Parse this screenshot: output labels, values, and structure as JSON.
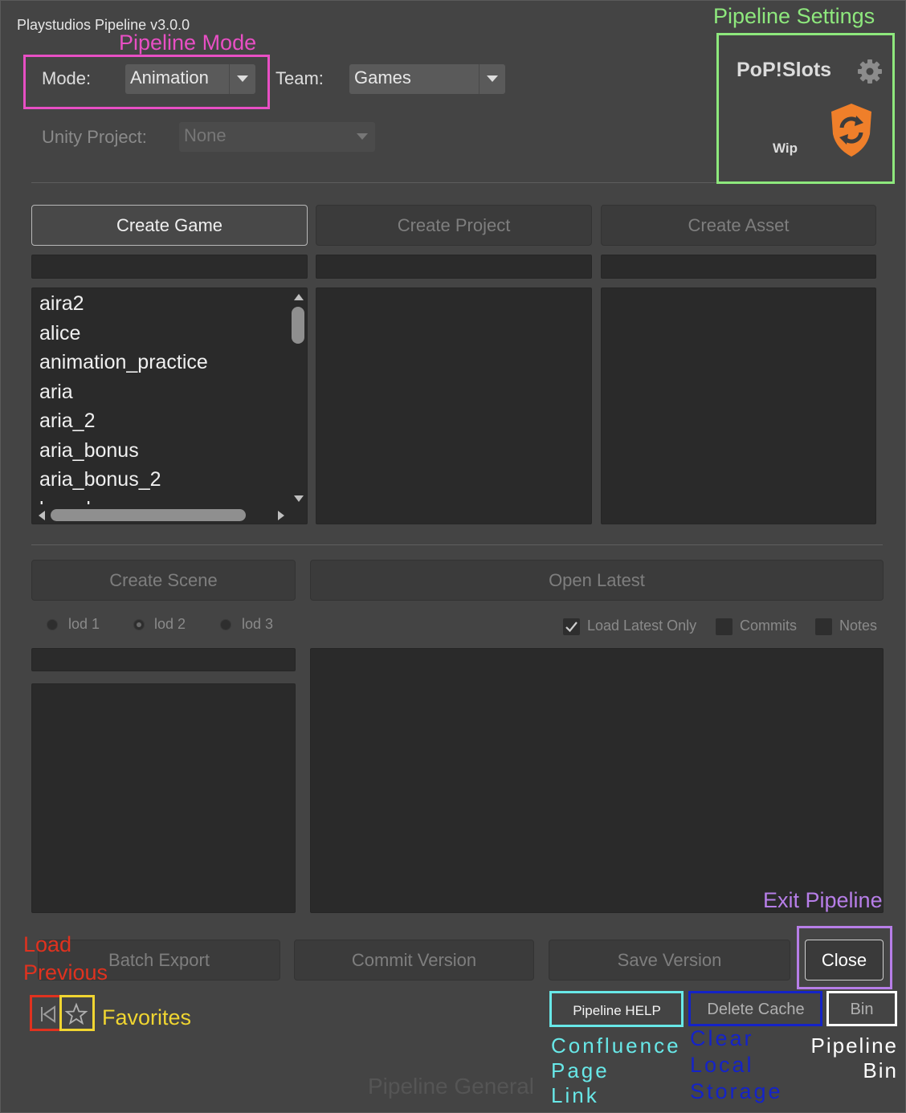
{
  "window": {
    "title": "Playstudios Pipeline v3.0.0"
  },
  "mode": {
    "label": "Mode:",
    "value": "Animation"
  },
  "team": {
    "label": "Team:",
    "value": "Games"
  },
  "unity": {
    "label": "Unity Project:",
    "value": "None"
  },
  "settings": {
    "game_name": "PoP!Slots",
    "status": "Wip"
  },
  "create_buttons": {
    "game": "Create Game",
    "project": "Create Project",
    "asset": "Create Asset"
  },
  "games_list": [
    "aira2",
    "alice",
    "animation_practice",
    "aria",
    "aria_2",
    "aria_bonus",
    "aria_bonus_2",
    "board"
  ],
  "scene": {
    "create_scene": "Create Scene",
    "open_latest": "Open Latest",
    "lods": [
      {
        "label": "lod 1",
        "selected": false
      },
      {
        "label": "lod 2",
        "selected": true
      },
      {
        "label": "lod 3",
        "selected": false
      }
    ],
    "load_latest_only": "Load Latest Only",
    "commits": "Commits",
    "notes": "Notes"
  },
  "actions": {
    "batch_export": "Batch Export",
    "commit_version": "Commit Version",
    "save_version": "Save Version",
    "close": "Close",
    "pipeline_help": "Pipeline HELP",
    "delete_cache": "Delete Cache",
    "bin": "Bin"
  },
  "footer_label": "Pipeline General",
  "annotations": {
    "pipeline_mode": "Pipeline Mode",
    "pipeline_settings": "Pipeline Settings",
    "exit_pipeline": "Exit Pipeline",
    "load_previous_1": "Load",
    "load_previous_2": "Previous",
    "favorites": "Favorites",
    "confluence_1": "Confluence",
    "confluence_2": "Page",
    "confluence_3": "Link",
    "clear_1": "Clear",
    "clear_2": "Local",
    "clear_3": "Storage",
    "pipeline_bin_1": "Pipeline",
    "pipeline_bin_2": "Bin"
  },
  "colors": {
    "pink": "#e84fc4",
    "green": "#8ee87d",
    "purple": "#b77ee8",
    "red": "#e0321f",
    "yellow": "#f0d531",
    "cyan": "#68e8e8",
    "blue": "#1423c8",
    "white": "#ffffff",
    "shield_orange": "#ef7f2a"
  }
}
